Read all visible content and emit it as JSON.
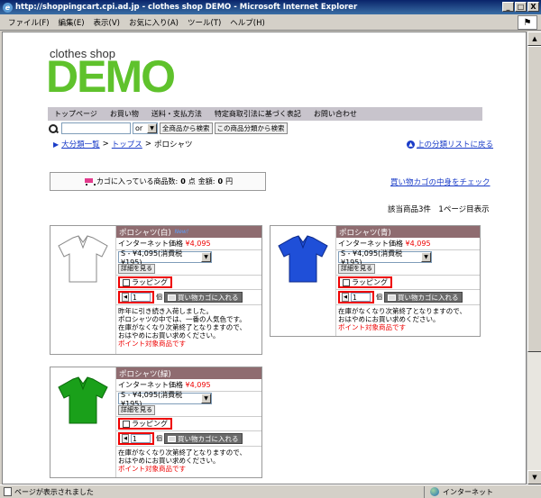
{
  "window": {
    "title": "http://shoppingcart.cpi.ad.jp - clothes shop DEMO - Microsoft Internet Explorer",
    "controls": [
      "_",
      "□",
      "X"
    ]
  },
  "menubar": [
    "ファイル(F)",
    "編集(E)",
    "表示(V)",
    "お気に入り(A)",
    "ツール(T)",
    "ヘルプ(H)"
  ],
  "logo": {
    "small": "clothes shop",
    "big": "DEMO",
    "color": "#5fc22c"
  },
  "nav": [
    "トップページ",
    "お買い物",
    "送料・支払方法",
    "特定商取引法に基づく表記",
    "お問い合わせ"
  ],
  "search": {
    "operator": "or",
    "all_button": "全商品から検索",
    "category_button": "この商品分類から検索"
  },
  "breadcrumb": {
    "root": "大分類一覧",
    "sep": ">",
    "top": "トップス",
    "current": "ポロシャツ"
  },
  "uplink": "上の分類リストに戻る",
  "cart": {
    "label": "カゴに入っている商品数:",
    "count": "0",
    "count_unit": "点",
    "total_label": "金額:",
    "total": "0",
    "total_unit": "円",
    "check_link": "買い物カゴの中身をチェック"
  },
  "result_count": "該当商品3件　1ページ目表示",
  "products": [
    {
      "name": "ポロシャツ(白)",
      "badge": "New!",
      "color": "#ffffff",
      "price_label": "インターネット価格",
      "price": "¥4,095",
      "option": "S - ¥4,095(消費税¥195)",
      "detail_button": "詳細を見る",
      "wrapping_label": "ラッピング",
      "qty": "1",
      "qty_unit": "個",
      "add_button": "買い物カゴに入れる",
      "desc": [
        "昨年に引き続き入荷しました。",
        "ポロシャツの中では、一番の人気色です。",
        "在庫がなくなり次第終了となりますので、",
        "おはやめにお買い求めください。"
      ],
      "point": "ポイント対象商品です"
    },
    {
      "name": "ポロシャツ(青)",
      "badge": "",
      "color": "#1f4fd8",
      "price_label": "インターネット価格",
      "price": "¥4,095",
      "option": "S - ¥4,095(消費税¥195)",
      "detail_button": "詳細を見る",
      "wrapping_label": "ラッピング",
      "qty": "1",
      "qty_unit": "個",
      "add_button": "買い物カゴに入れる",
      "desc": [
        "在庫がなくなり次第終了となりますので、",
        "おはやめにお買い求めください。"
      ],
      "point": "ポイント対象商品です"
    },
    {
      "name": "ポロシャツ(緑)",
      "badge": "",
      "color": "#1aa01a",
      "price_label": "インターネット価格",
      "price": "¥4,095",
      "option": "S - ¥4,095(消費税¥195)",
      "detail_button": "詳細を見る",
      "wrapping_label": "ラッピング",
      "qty": "1",
      "qty_unit": "個",
      "add_button": "買い物カゴに入れる",
      "desc": [
        "在庫がなくなり次第終了となりますので、",
        "おはやめにお買い求めください。"
      ],
      "point": "ポイント対象商品です"
    }
  ],
  "status": {
    "left": "ページが表示されました",
    "right": "インターネット"
  }
}
